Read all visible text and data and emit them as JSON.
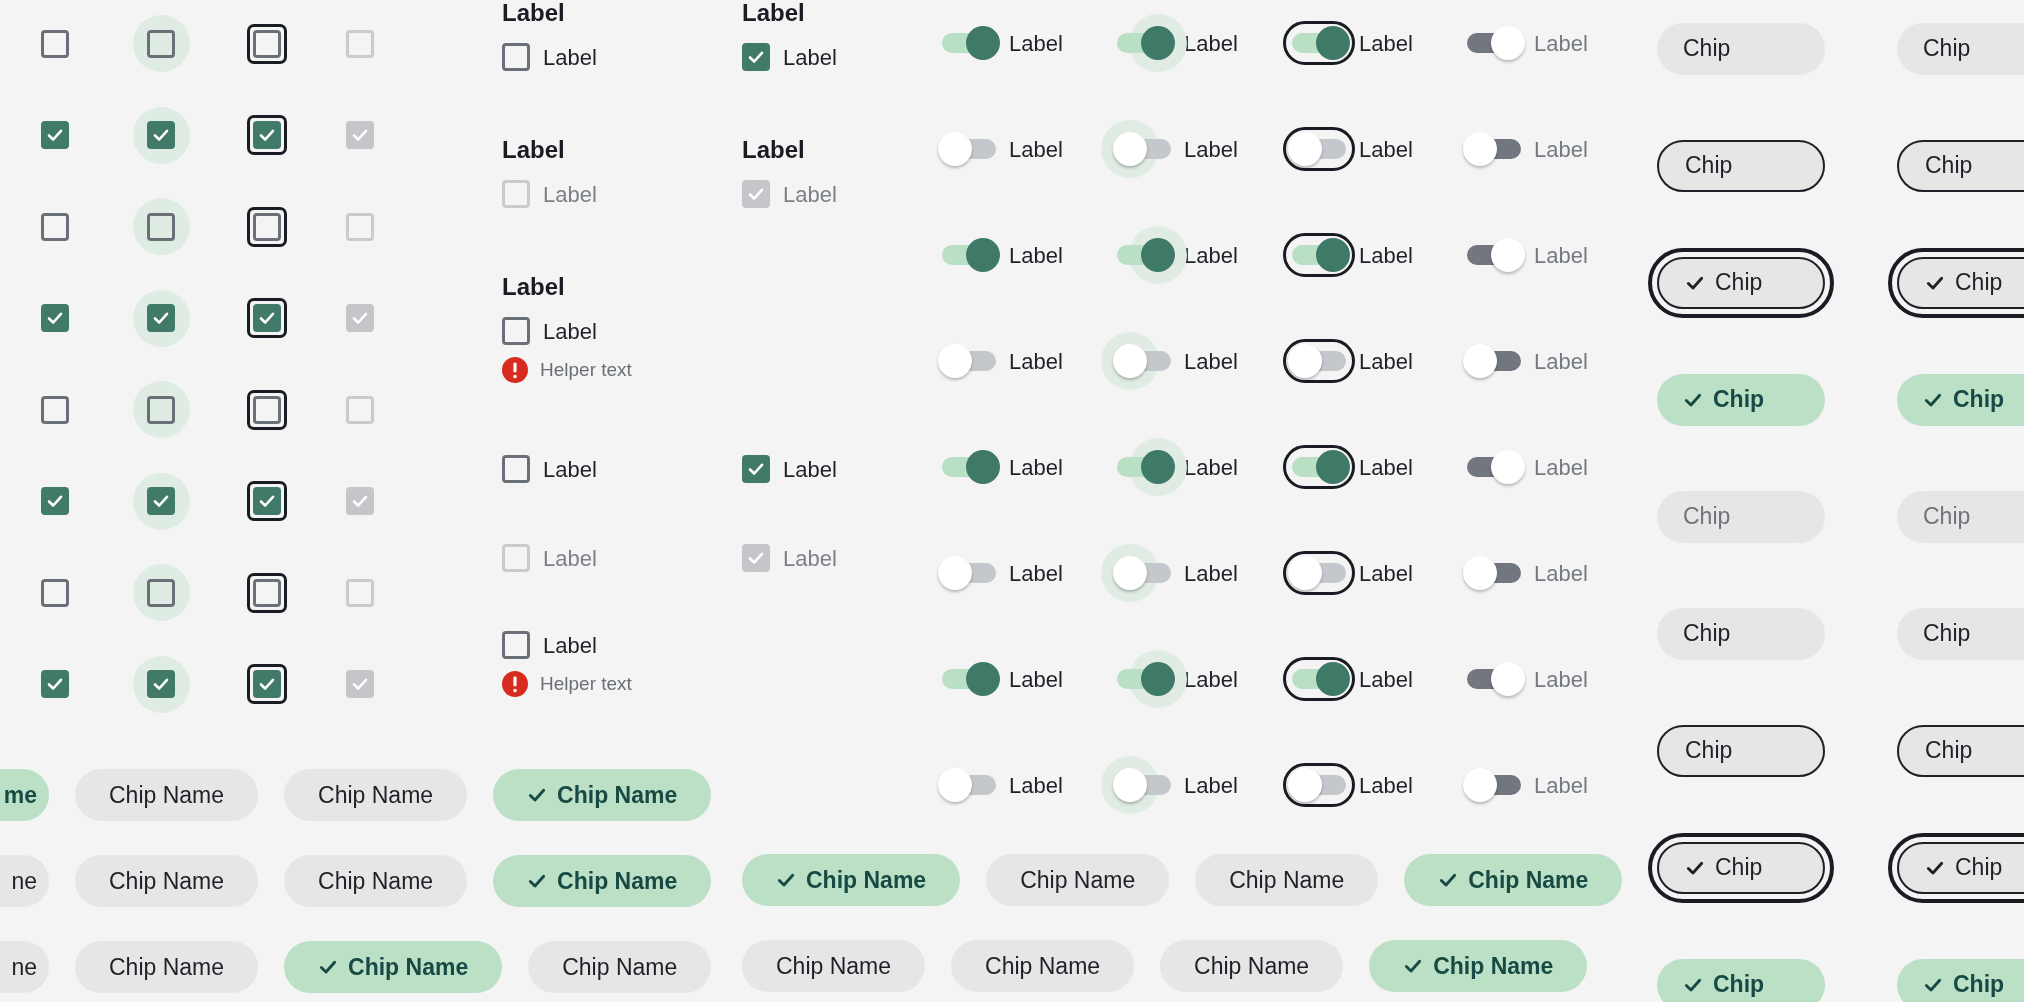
{
  "checkbox_grid": [
    {
      "cells": [
        {
          "kind": "default",
          "checked": false
        },
        {
          "kind": "hover",
          "checked": false
        },
        {
          "kind": "focus",
          "checked": false
        },
        {
          "kind": "disabled",
          "checked": false
        }
      ]
    },
    {
      "cells": [
        {
          "kind": "default",
          "checked": true
        },
        {
          "kind": "hover",
          "checked": true
        },
        {
          "kind": "focus",
          "checked": true
        },
        {
          "kind": "disabled",
          "checked": true
        }
      ]
    },
    {
      "cells": [
        {
          "kind": "default",
          "checked": false
        },
        {
          "kind": "hover",
          "checked": false
        },
        {
          "kind": "focus",
          "checked": false
        },
        {
          "kind": "disabled",
          "checked": false
        }
      ]
    },
    {
      "cells": [
        {
          "kind": "default",
          "checked": true
        },
        {
          "kind": "hover",
          "checked": true
        },
        {
          "kind": "focus",
          "checked": true
        },
        {
          "kind": "disabled",
          "checked": true
        }
      ]
    },
    {
      "cells": [
        {
          "kind": "default",
          "checked": false
        },
        {
          "kind": "hover",
          "checked": false
        },
        {
          "kind": "focus",
          "checked": false
        },
        {
          "kind": "disabled",
          "checked": false
        }
      ]
    },
    {
      "cells": [
        {
          "kind": "default",
          "checked": true
        },
        {
          "kind": "hover",
          "checked": true
        },
        {
          "kind": "focus",
          "checked": true
        },
        {
          "kind": "disabled",
          "checked": true
        }
      ]
    },
    {
      "cells": [
        {
          "kind": "default",
          "checked": false
        },
        {
          "kind": "hover",
          "checked": false
        },
        {
          "kind": "focus",
          "checked": false
        },
        {
          "kind": "disabled",
          "checked": false
        }
      ]
    },
    {
      "cells": [
        {
          "kind": "default",
          "checked": true
        },
        {
          "kind": "hover",
          "checked": true
        },
        {
          "kind": "focus",
          "checked": true
        },
        {
          "kind": "disabled",
          "checked": true
        }
      ]
    }
  ],
  "checkbox_field_rows": [
    {
      "fields": [
        {
          "heading": "Label",
          "label": "Label",
          "checked": false,
          "disabled": false
        },
        {
          "heading": "Label",
          "label": "Label",
          "checked": true,
          "disabled": false
        }
      ]
    },
    {
      "fields": [
        {
          "heading": "Label",
          "label": "Label",
          "checked": false,
          "disabled": true
        },
        {
          "heading": "Label",
          "label": "Label",
          "checked": true,
          "disabled": true
        }
      ]
    },
    {
      "fields": [
        {
          "heading": "Label",
          "label": "Label",
          "checked": false,
          "disabled": false,
          "helper": "Helper text"
        }
      ]
    },
    {
      "fields": [
        {
          "label": "Label",
          "checked": false,
          "disabled": false
        },
        {
          "label": "Label",
          "checked": true,
          "disabled": false
        }
      ]
    },
    {
      "fields": [
        {
          "label": "Label",
          "checked": false,
          "disabled": true
        },
        {
          "label": "Label",
          "checked": true,
          "disabled": true
        }
      ]
    },
    {
      "fields": [
        {
          "label": "Label",
          "checked": false,
          "disabled": false,
          "helper": "Helper text"
        }
      ]
    }
  ],
  "toggle_grid": [
    {
      "cells": [
        {
          "kind": "default",
          "on": true,
          "label": "Label"
        },
        {
          "kind": "hover",
          "on": true,
          "label": "Label"
        },
        {
          "kind": "focus",
          "on": true,
          "label": "Label"
        },
        {
          "kind": "disabled",
          "on": true,
          "label": "Label"
        }
      ]
    },
    {
      "cells": [
        {
          "kind": "default",
          "on": false,
          "label": "Label"
        },
        {
          "kind": "hover",
          "on": false,
          "label": "Label"
        },
        {
          "kind": "focus",
          "on": false,
          "label": "Label"
        },
        {
          "kind": "disabled",
          "on": false,
          "label": "Label"
        }
      ]
    },
    {
      "cells": [
        {
          "kind": "default",
          "on": true,
          "label": "Label"
        },
        {
          "kind": "hover",
          "on": true,
          "label": "Label"
        },
        {
          "kind": "focus",
          "on": true,
          "label": "Label"
        },
        {
          "kind": "disabled",
          "on": true,
          "label": "Label"
        }
      ]
    },
    {
      "cells": [
        {
          "kind": "default",
          "on": false,
          "label": "Label"
        },
        {
          "kind": "hover",
          "on": false,
          "label": "Label"
        },
        {
          "kind": "focus",
          "on": false,
          "label": "Label"
        },
        {
          "kind": "disabled",
          "on": false,
          "label": "Label"
        }
      ]
    },
    {
      "cells": [
        {
          "kind": "default",
          "on": true,
          "label": "Label"
        },
        {
          "kind": "hover",
          "on": true,
          "label": "Label"
        },
        {
          "kind": "focus",
          "on": true,
          "label": "Label"
        },
        {
          "kind": "disabled",
          "on": true,
          "label": "Label"
        }
      ]
    },
    {
      "cells": [
        {
          "kind": "default",
          "on": false,
          "label": "Label"
        },
        {
          "kind": "hover",
          "on": false,
          "label": "Label"
        },
        {
          "kind": "focus",
          "on": false,
          "label": "Label"
        },
        {
          "kind": "disabled",
          "on": false,
          "label": "Label"
        }
      ]
    },
    {
      "cells": [
        {
          "kind": "default",
          "on": true,
          "label": "Label"
        },
        {
          "kind": "hover",
          "on": true,
          "label": "Label"
        },
        {
          "kind": "focus",
          "on": true,
          "label": "Label"
        },
        {
          "kind": "disabled",
          "on": true,
          "label": "Label"
        }
      ]
    },
    {
      "cells": [
        {
          "kind": "default",
          "on": false,
          "label": "Label"
        },
        {
          "kind": "hover",
          "on": false,
          "label": "Label"
        },
        {
          "kind": "focus",
          "on": false,
          "label": "Label"
        },
        {
          "kind": "disabled",
          "on": false,
          "label": "Label"
        }
      ]
    }
  ],
  "chip_grid": [
    {
      "cells": [
        {
          "kind": "default",
          "label": "Chip",
          "selected": false
        },
        {
          "kind": "default",
          "label": "Chip",
          "selected": false
        }
      ]
    },
    {
      "cells": [
        {
          "kind": "outlined",
          "label": "Chip",
          "selected": false
        },
        {
          "kind": "outlined",
          "label": "Chip",
          "selected": false
        }
      ]
    },
    {
      "cells": [
        {
          "kind": "focus",
          "label": "Chip",
          "selected": true
        },
        {
          "kind": "focus",
          "label": "Chip",
          "selected": true
        }
      ]
    },
    {
      "cells": [
        {
          "kind": "default",
          "label": "Chip",
          "selected": true
        },
        {
          "kind": "default",
          "label": "Chip",
          "selected": true
        }
      ]
    },
    {
      "cells": [
        {
          "kind": "disabled",
          "label": "Chip",
          "selected": false
        },
        {
          "kind": "disabled",
          "label": "Chip",
          "selected": false
        }
      ]
    },
    {
      "cells": [
        {
          "kind": "default",
          "label": "Chip",
          "selected": false
        },
        {
          "kind": "default",
          "label": "Chip",
          "selected": false
        }
      ]
    },
    {
      "cells": [
        {
          "kind": "outlined",
          "label": "Chip",
          "selected": false
        },
        {
          "kind": "outlined",
          "label": "Chip",
          "selected": false
        }
      ]
    },
    {
      "cells": [
        {
          "kind": "focus",
          "label": "Chip",
          "selected": true
        },
        {
          "kind": "focus",
          "label": "Chip",
          "selected": true
        }
      ]
    },
    {
      "cells": [
        {
          "kind": "default",
          "label": "Chip",
          "selected": true
        },
        {
          "kind": "default",
          "label": "Chip",
          "selected": true
        }
      ]
    }
  ],
  "chip_rows_left": [
    {
      "chips": [
        {
          "kind": "clipped",
          "label": "me",
          "selected": true
        },
        {
          "kind": "default",
          "label": "Chip Name",
          "selected": false
        },
        {
          "kind": "default",
          "label": "Chip Name",
          "selected": false
        },
        {
          "kind": "default",
          "label": "Chip Name",
          "selected": true
        }
      ]
    },
    {
      "chips": [
        {
          "kind": "clipped",
          "label": "ne",
          "selected": false
        },
        {
          "kind": "default",
          "label": "Chip Name",
          "selected": false
        },
        {
          "kind": "default",
          "label": "Chip Name",
          "selected": false
        },
        {
          "kind": "default",
          "label": "Chip Name",
          "selected": true
        }
      ]
    },
    {
      "chips": [
        {
          "kind": "clipped",
          "label": "ne",
          "selected": false
        },
        {
          "kind": "default",
          "label": "Chip Name",
          "selected": false
        },
        {
          "kind": "default",
          "label": "Chip Name",
          "selected": true
        },
        {
          "kind": "default",
          "label": "Chip Name",
          "selected": false
        }
      ]
    }
  ],
  "chip_rows_middle": [
    {
      "chips": [
        {
          "kind": "default",
          "label": "Chip Name",
          "selected": true
        },
        {
          "kind": "default",
          "label": "Chip Name",
          "selected": false
        },
        {
          "kind": "default",
          "label": "Chip Name",
          "selected": false
        },
        {
          "kind": "default",
          "label": "Chip Name",
          "selected": true
        }
      ]
    },
    {
      "chips": [
        {
          "kind": "default",
          "label": "Chip Name",
          "selected": false
        },
        {
          "kind": "default",
          "label": "Chip Name",
          "selected": false
        },
        {
          "kind": "default",
          "label": "Chip Name",
          "selected": false
        },
        {
          "kind": "default",
          "label": "Chip Name",
          "selected": true
        }
      ]
    }
  ]
}
